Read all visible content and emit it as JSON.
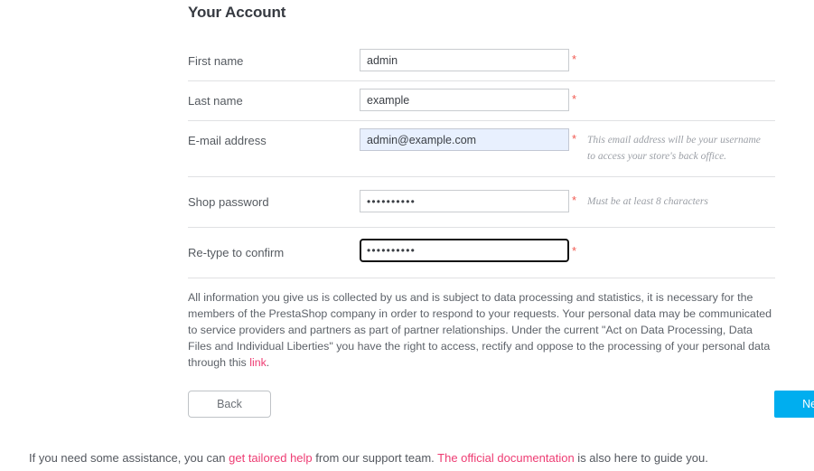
{
  "form": {
    "section_title": "Your Account",
    "rows": [
      {
        "label": "First name",
        "value": "admin",
        "required_marker": "*",
        "hint": "",
        "state": "normal",
        "type": "text"
      },
      {
        "label": "Last name",
        "value": "example",
        "required_marker": "*",
        "hint": "",
        "state": "normal",
        "type": "text"
      },
      {
        "label": "E-mail address",
        "value": "admin@example.com",
        "required_marker": "*",
        "hint": "This email address will be your username to access your store's back office.",
        "state": "autofilled",
        "type": "text"
      },
      {
        "label": "Shop password",
        "value": "••••••••••",
        "required_marker": "*",
        "hint": "Must be at least 8 characters",
        "state": "normal",
        "type": "password"
      },
      {
        "label": "Re-type to confirm",
        "value": "••••••••••",
        "required_marker": "*",
        "hint": "",
        "state": "focused",
        "type": "password"
      }
    ]
  },
  "legal": {
    "part1": "All information you give us is collected by us and is subject to data processing and statistics, it is necessary for the members of the PrestaShop company in order to respond to your requests. Your personal data may be communicated to service providers and partners as part of partner relationships. Under the current \"Act on Data Processing, Data Files and Individual Liberties\" you have the right to access, rectify and oppose to the processing of your personal data through this ",
    "link_text": "link",
    "part2": "."
  },
  "buttons": {
    "back_label": "Back",
    "next_label": "Next"
  },
  "footer": {
    "part1": "If you need some assistance, you can ",
    "link1": "get tailored help",
    "part2": " from our support team. ",
    "link2": "The official documentation",
    "part3": " is also here to guide you."
  },
  "colors": {
    "accent_blue": "#00aeef",
    "link_pink": "#ee3c73",
    "required_red": "#f15b52",
    "autofill_bg": "#e8f0fe",
    "heading": "#363a41"
  }
}
